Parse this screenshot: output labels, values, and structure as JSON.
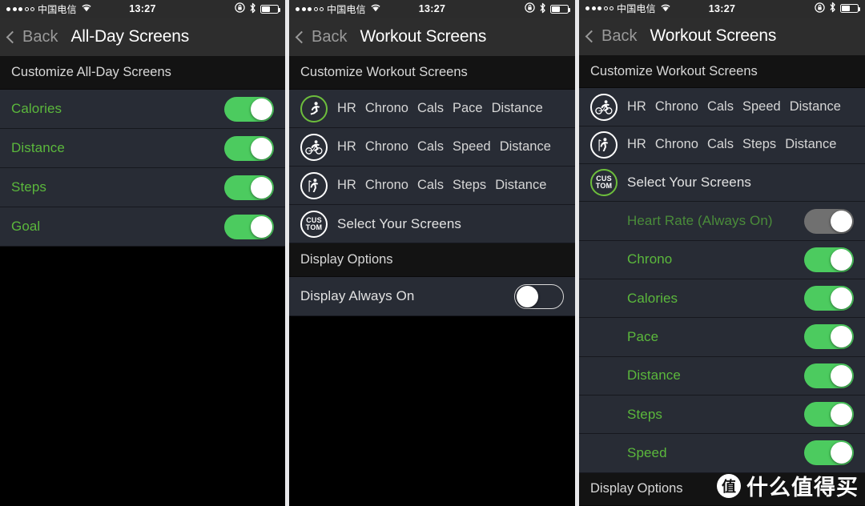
{
  "status_bar": {
    "signal_dots_filled": 3,
    "signal_dots_total": 5,
    "carrier": "中国电信",
    "wifi_icon": "wifi-icon",
    "time": "13:27",
    "rotation_lock_icon": "rotation-lock-icon",
    "bluetooth_icon": "bluetooth-icon",
    "battery_icon": "battery-icon",
    "battery_level_pct": 48
  },
  "colors": {
    "accent_green": "#4ccb5f",
    "label_green": "#5bb83c",
    "label_green_dim": "#4a8c3a",
    "row_bg": "#282c35",
    "section_bg": "#131313",
    "nav_bg": "#2d2d2d",
    "divider": "#16181e"
  },
  "panels": [
    {
      "id": "all-day-screens",
      "nav": {
        "back_label": "Back",
        "title": "All-Day Screens"
      },
      "section_header": "Customize All-Day Screens",
      "toggle_rows": [
        {
          "label": "Calories",
          "state": "on"
        },
        {
          "label": "Distance",
          "state": "on"
        },
        {
          "label": "Steps",
          "state": "on"
        },
        {
          "label": "Goal",
          "state": "on"
        }
      ]
    },
    {
      "id": "workout-screens",
      "nav": {
        "back_label": "Back",
        "title": "Workout Screens"
      },
      "section_header": "Customize Workout Screens",
      "activity_rows": [
        {
          "icon": "running-icon",
          "icon_selected": true,
          "metrics": [
            "HR",
            "Chrono",
            "Cals",
            "Pace",
            "Distance"
          ]
        },
        {
          "icon": "cycling-icon",
          "icon_selected": false,
          "metrics": [
            "HR",
            "Chrono",
            "Cals",
            "Speed",
            "Distance"
          ]
        },
        {
          "icon": "hiking-icon",
          "icon_selected": false,
          "metrics": [
            "HR",
            "Chrono",
            "Cals",
            "Steps",
            "Distance"
          ]
        }
      ],
      "custom_row": {
        "icon_line1": "CUS",
        "icon_line2": "TOM",
        "icon_selected": false,
        "label": "Select Your Screens"
      },
      "display_options_header": "Display Options",
      "display_rows": [
        {
          "label": "Display Always On",
          "state": "off"
        }
      ]
    },
    {
      "id": "workout-screens-custom",
      "nav": {
        "back_label": "Back",
        "title": "Workout Screens"
      },
      "section_header": "Customize Workout Screens",
      "activity_rows": [
        {
          "icon": "cycling-icon",
          "icon_selected": false,
          "metrics": [
            "HR",
            "Chrono",
            "Cals",
            "Speed",
            "Distance"
          ]
        },
        {
          "icon": "hiking-icon",
          "icon_selected": false,
          "metrics": [
            "HR",
            "Chrono",
            "Cals",
            "Steps",
            "Distance"
          ]
        }
      ],
      "custom_row": {
        "icon_line1": "CUS",
        "icon_line2": "TOM",
        "icon_selected": true,
        "label": "Select Your Screens"
      },
      "toggle_rows": [
        {
          "label": "Heart Rate (Always On)",
          "state": "gray"
        },
        {
          "label": "Chrono",
          "state": "on"
        },
        {
          "label": "Calories",
          "state": "on"
        },
        {
          "label": "Pace",
          "state": "on"
        },
        {
          "label": "Distance",
          "state": "on"
        },
        {
          "label": "Steps",
          "state": "on"
        },
        {
          "label": "Speed",
          "state": "on"
        }
      ],
      "display_options_header": "Display Options"
    }
  ],
  "watermark": {
    "badge": "值",
    "text": "什么值得买"
  }
}
